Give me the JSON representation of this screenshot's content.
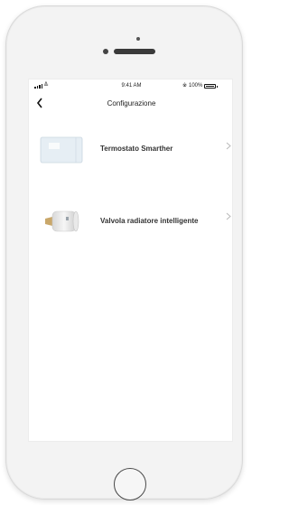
{
  "status_bar": {
    "time": "9:41 AM",
    "battery_percent": "100%",
    "bluetooth_icon": "bluetooth-icon",
    "wifi_icon": "wifi-icon",
    "signal_icon": "cellular-signal-icon"
  },
  "nav": {
    "title": "Configurazione",
    "back_icon": "chevron-left-icon"
  },
  "devices": [
    {
      "label": "Termostato Smarther",
      "image": "thermostat-image",
      "chevron": "chevron-right-icon"
    },
    {
      "label": "Valvola radiatore intelligente",
      "image": "radiator-valve-image",
      "chevron": "chevron-right-icon"
    }
  ],
  "colors": {
    "background": "#ffffff",
    "text": "#333333",
    "chevron": "#b8b8b8",
    "thermostat_face": "#dde9f2"
  }
}
